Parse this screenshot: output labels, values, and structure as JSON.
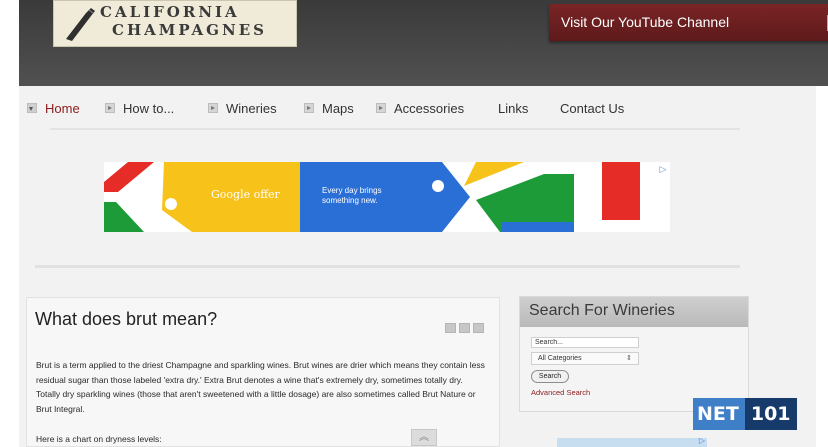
{
  "header": {
    "logo": {
      "line1": "CALIFORNIA",
      "line2": "CHAMPAGNES"
    },
    "youtube_banner": "Visit Our YouTube Channel"
  },
  "nav": {
    "items": [
      {
        "label": "Home",
        "active": true,
        "arrow": true
      },
      {
        "label": "How to...",
        "active": false,
        "arrow": true
      },
      {
        "label": "Wineries",
        "active": false,
        "arrow": true
      },
      {
        "label": "Maps",
        "active": false,
        "arrow": true
      },
      {
        "label": "Accessories",
        "active": false,
        "arrow": true
      },
      {
        "label": "Links",
        "active": false,
        "arrow": false
      },
      {
        "label": "Contact Us",
        "active": false,
        "arrow": false
      }
    ]
  },
  "ad": {
    "brand_text": "Google offer",
    "tagline": "Every day brings something new.",
    "colors": {
      "red": "#e52c27",
      "yellow": "#f7c21a",
      "blue": "#2a6fd6",
      "green": "#1d9b39"
    }
  },
  "article": {
    "title": "What does brut mean?",
    "body": "Brut is a term applied to the driest Champagne and sparkling wines. Brut wines are drier which means they contain less residual sugar than those labeled 'extra dry.' Extra Brut denotes a wine that's extremely dry, sometimes totally dry. Totally dry sparkling wines (those that aren't sweetened with a little dosage) are also sometimes called Brut Nature or Brut Integral.",
    "chart_intro": "Here is a chart on dryness levels:"
  },
  "search": {
    "title": "Search For Wineries",
    "placeholder": "Search...",
    "category_selected": "All Categories",
    "button_label": "Search",
    "advanced_link": "Advanced Search"
  },
  "watermark": {
    "net": "NET",
    "num": "101"
  },
  "colors": {
    "accent": "#8a1c1c",
    "youtube_banner": "#6e1f20",
    "header_bg": "#474747"
  }
}
